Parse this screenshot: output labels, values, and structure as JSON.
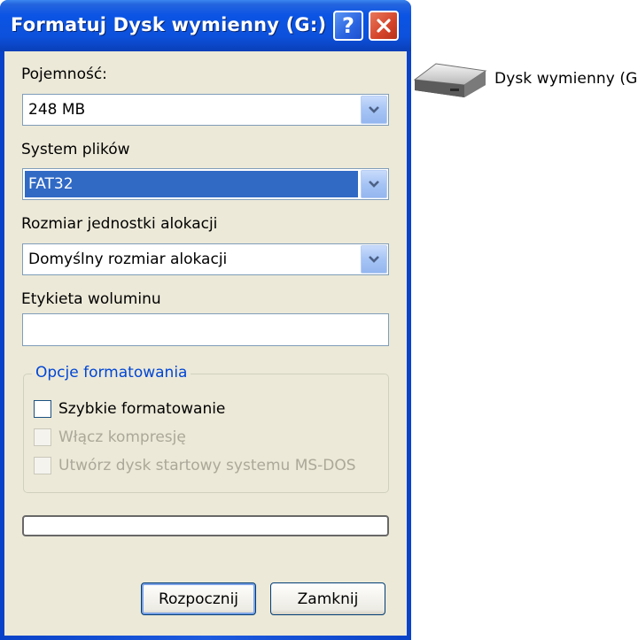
{
  "window": {
    "title": "Formatuj Dysk wymienny (G:)",
    "help_label": "?",
    "close_icon": "close-icon"
  },
  "capacity": {
    "label": "Pojemność:",
    "value": "248 MB"
  },
  "file_system": {
    "label": "System plików",
    "value": "FAT32"
  },
  "allocation": {
    "label": "Rozmiar jednostki alokacji",
    "value": "Domyślny rozmiar alokacji"
  },
  "volume_label": {
    "label": "Etykieta woluminu",
    "value": ""
  },
  "format_options": {
    "title": "Opcje formatowania",
    "quick_format": {
      "label": "Szybkie formatowanie",
      "checked": false,
      "enabled": true
    },
    "compression": {
      "label": "Włącz kompresję",
      "checked": false,
      "enabled": false
    },
    "ms_dos_startup": {
      "label": "Utwórz dysk startowy systemu MS-DOS",
      "checked": false,
      "enabled": false
    }
  },
  "progress": {
    "fraction": 0
  },
  "buttons": {
    "start": "Rozpocznij",
    "close": "Zamknij"
  },
  "desktop": {
    "drive_label": "Dysk wymienny (G",
    "icon": "removable-drive-icon"
  },
  "colors": {
    "title_bar": "#0c51dc",
    "dialog_bg": "#ece9d8",
    "selection": "#316ac5",
    "group_title": "#0046d5",
    "close_button": "#d4432a",
    "progress_fill": "#2fb12c"
  }
}
